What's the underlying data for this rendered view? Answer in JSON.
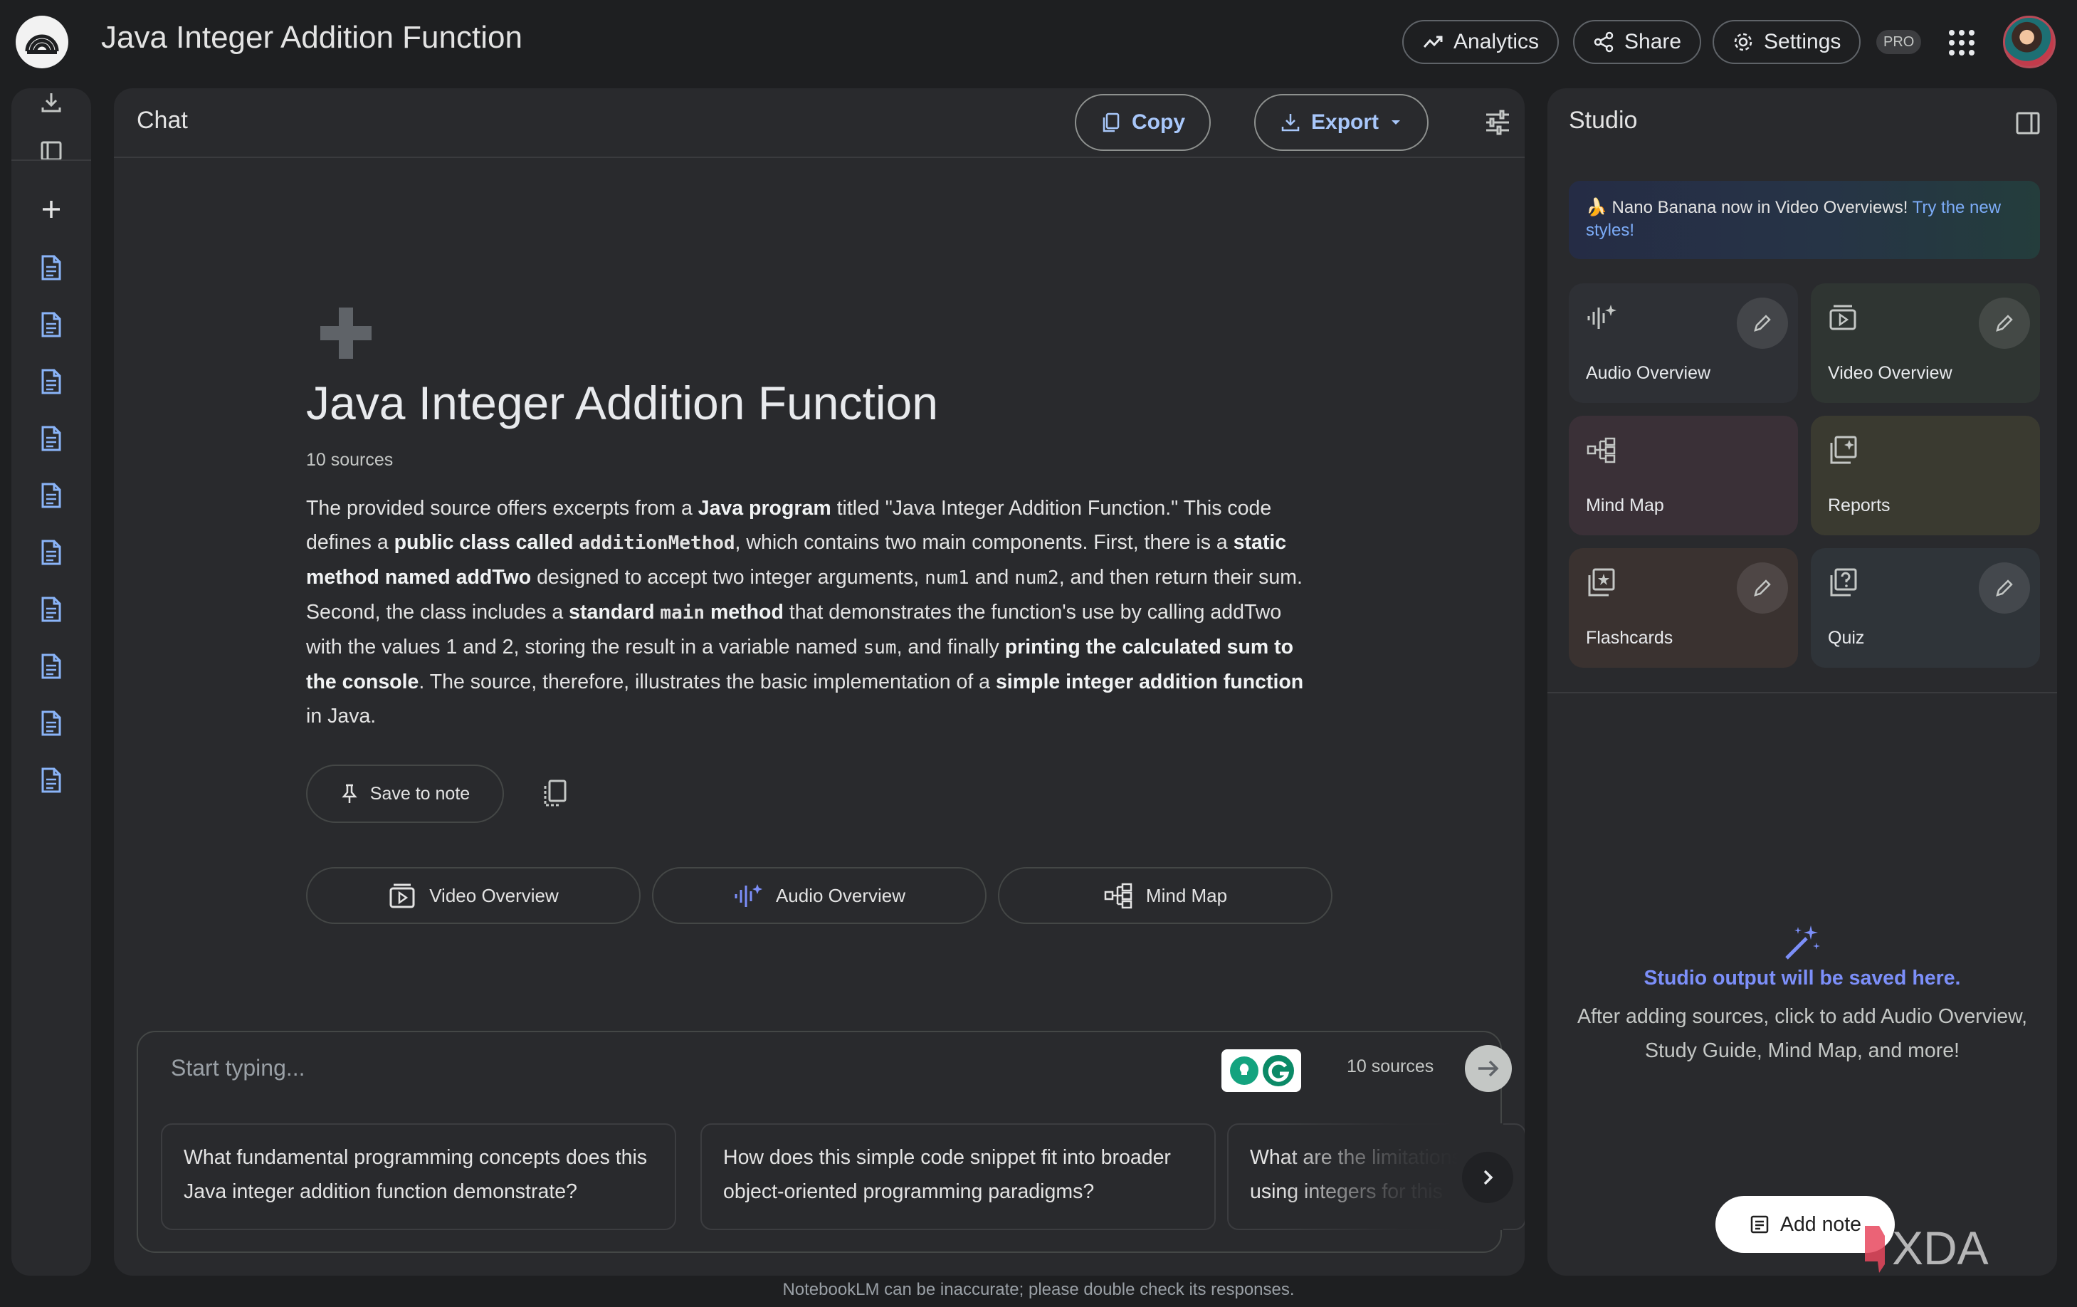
{
  "header": {
    "title": "Java Integer Addition Function",
    "analytics_label": "Analytics",
    "share_label": "Share",
    "settings_label": "Settings",
    "pro_badge": "PRO"
  },
  "left_rail": {
    "source_count_icons": 10
  },
  "chat": {
    "title": "Chat",
    "copy_label": "Copy",
    "export_label": "Export",
    "notebook_title": "Java Integer Addition Function",
    "sources_count": "10 sources",
    "summary": {
      "s1": "The provided source offers excerpts from a ",
      "s2": "Java program",
      "s3": " titled \"Java Integer Addition Function.\" This code defines a ",
      "s4": "public class called ",
      "s5": "additionMethod",
      "s6": ", which contains two main components. First, there is a ",
      "s7": "static method named ",
      "s8": "addTwo",
      "s9": " designed to accept two integer arguments, ",
      "s10": "num1",
      "s11": " and ",
      "s12": "num2",
      "s13": ", and then return their sum. Second, the class includes a ",
      "s14": "standard ",
      "s15": "main",
      "s16": " method",
      "s17": " that demonstrates the function's use by calling addTwo with the values 1 and 2, storing the result in a variable named ",
      "s18": "sum",
      "s19": ", and finally ",
      "s20": "printing the calculated sum to the console",
      "s21": ". The source, therefore, illustrates the basic implementation of a ",
      "s22": "simple integer addition function",
      "s23": " in Java."
    },
    "save_to_note_label": "Save to note",
    "chips": [
      "Video Overview",
      "Audio Overview",
      "Mind Map"
    ],
    "input_placeholder": "Start typing...",
    "input_sources": "10 sources",
    "suggestions": [
      "What fundamental programming concepts does this Java integer addition function demonstrate?",
      "How does this simple code snippet fit into broader object-oriented programming paradigms?",
      "What are the limitations of using integers for this"
    ],
    "disclaimer": "NotebookLM can be inaccurate; please double check its responses."
  },
  "studio": {
    "title": "Studio",
    "banner_text": "🍌 Nano Banana now in Video Overviews! ",
    "banner_link": "Try the new styles!",
    "tiles": [
      {
        "label": "Audio Overview",
        "icon": "audio-waveform-icon",
        "color": "#2e3035"
      },
      {
        "label": "Video Overview",
        "icon": "video-icon",
        "color": "#2f3532"
      },
      {
        "label": "Mind Map",
        "icon": "mind-map-icon",
        "color": "#3a3037"
      },
      {
        "label": "Reports",
        "icon": "reports-icon",
        "color": "#3a3a30"
      },
      {
        "label": "Flashcards",
        "icon": "flashcards-icon",
        "color": "#3a3230"
      },
      {
        "label": "Quiz",
        "icon": "quiz-icon",
        "color": "#2f3439"
      }
    ],
    "empty_title": "Studio output will be saved here.",
    "empty_desc": "After adding sources, click to add Audio Overview, Study Guide, Mind Map, and more!",
    "add_note_label": "Add note"
  },
  "watermark": "XDA",
  "colors": {
    "background": "#1e1f21",
    "panel": "#292a2d",
    "accent_blue": "#a8c7fa",
    "studio_accent": "#7c8ff9",
    "doc_icon_blue": "#8ab4f8"
  }
}
